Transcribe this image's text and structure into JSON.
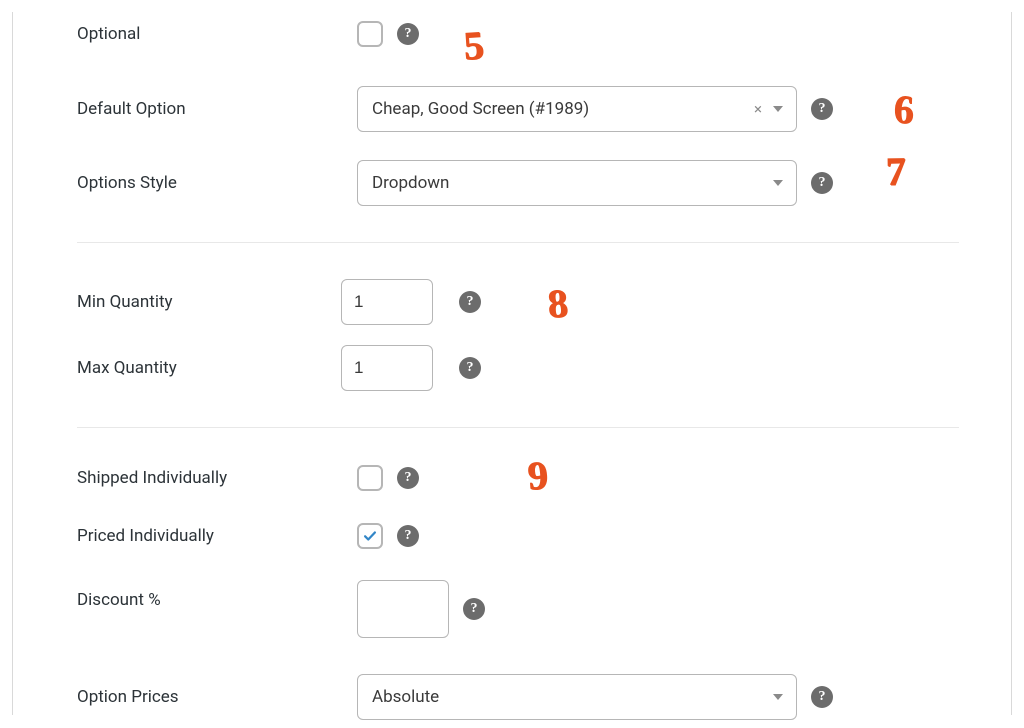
{
  "fields": {
    "optional": {
      "label": "Optional",
      "checked": false
    },
    "default_option": {
      "label": "Default Option",
      "value": "Cheap, Good Screen (#1989)"
    },
    "options_style": {
      "label": "Options Style",
      "value": "Dropdown"
    },
    "min_quantity": {
      "label": "Min Quantity",
      "value": "1"
    },
    "max_quantity": {
      "label": "Max Quantity",
      "value": "1"
    },
    "shipped_individually": {
      "label": "Shipped Individually",
      "checked": false
    },
    "priced_individually": {
      "label": "Priced Individually",
      "checked": true
    },
    "discount_pct": {
      "label": "Discount %",
      "value": ""
    },
    "option_prices": {
      "label": "Option Prices",
      "value": "Absolute"
    }
  },
  "annotations": {
    "a5": "5",
    "a6": "6",
    "a7": "7",
    "a8": "8",
    "a9": "9"
  },
  "icons": {
    "help_glyph": "?",
    "clear_glyph": "×"
  }
}
